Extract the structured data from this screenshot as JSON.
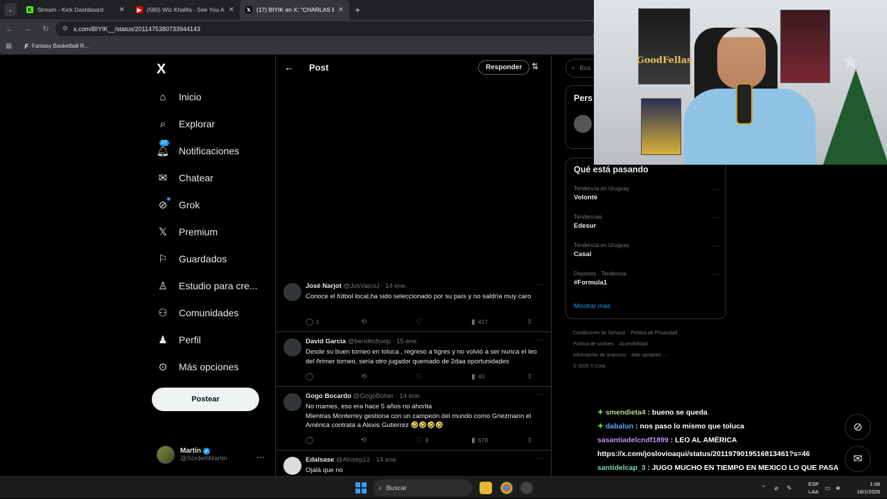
{
  "browser": {
    "tabs": [
      {
        "title": "Stream - Kick Dashboard",
        "favicon": "kick-icon",
        "active": false
      },
      {
        "title": "(580) Wiz Khalifa - See You Again",
        "favicon": "youtube-icon",
        "active": false
      },
      {
        "title": "(17) BIYIK en X: \"CHARLAS EN TO",
        "favicon": "x-icon",
        "active": true
      }
    ],
    "new_tab": "+",
    "url": "x.com/BIYIK__/status/2011475380733944143",
    "bookmarks": [
      {
        "label": "Fantasy Basketball R..."
      }
    ]
  },
  "nav": {
    "logo": "X",
    "items": [
      {
        "label": "Inicio",
        "icon": "home-icon"
      },
      {
        "label": "Explorar",
        "icon": "search-icon"
      },
      {
        "label": "Notificaciones",
        "icon": "bell-icon",
        "badge": "17"
      },
      {
        "label": "Chatear",
        "icon": "mail-icon"
      },
      {
        "label": "Grok",
        "icon": "grok-icon"
      },
      {
        "label": "Premium",
        "icon": "x-icon"
      },
      {
        "label": "Guardados",
        "icon": "bookmark-icon"
      },
      {
        "label": "Estudio para cre...",
        "icon": "studio-icon"
      },
      {
        "label": "Comunidades",
        "icon": "communities-icon"
      },
      {
        "label": "Perfil",
        "icon": "profile-icon"
      },
      {
        "label": "Más opciones",
        "icon": "more-icon"
      }
    ],
    "post_button": "Postear",
    "profile": {
      "name": "Martín",
      "handle": "@SordelliMartin"
    }
  },
  "post": {
    "title": "Post",
    "reply_button": "Responder",
    "replies": [
      {
        "name": "José Narjot",
        "handle": "@JosVaicoJ",
        "date": "14 ene.",
        "text": "Conoce el fútbol local,ha sido seleccionado por su país y no saldría muy caro",
        "replies": "1",
        "reposts": "",
        "likes": "",
        "views": "417"
      },
      {
        "name": "David Garcia",
        "handle": "@benditoboop",
        "date": "15 ene.",
        "text": "Desde su buen torneo en toluca , regreso a tigres y no volvió a ser nunca el leo del ñrimer torneo,  sería otro jugador quemado de 2daa oportunidades",
        "replies": "",
        "reposts": "",
        "likes": "",
        "views": "40"
      },
      {
        "name": "Gogo Bocardo",
        "handle": "@GogoBoher",
        "date": "14 ene.",
        "text": "No mames, eso era hace 5 años no ahorita\nMientras Monterrey gestiona con un campeón del mundo como Griezmann el América contrata a Alexis Gutierrez 🤣🤣🤣🤣",
        "replies": "",
        "reposts": "",
        "likes": "9",
        "views": "678"
      },
      {
        "name": "Edalsase",
        "handle": "@Alnsep12",
        "date": "14 ene.",
        "text": "Ojalá que no",
        "replies": "",
        "reposts": "",
        "likes": "",
        "views": ""
      }
    ]
  },
  "sidebar": {
    "search_placeholder": "Bus",
    "card_title": "Pers",
    "trends_title": "Qué está pasando",
    "trends": [
      {
        "context": "Tendencia en Uruguay",
        "name": "Volonté"
      },
      {
        "context": "Tendencias",
        "name": "Edesur"
      },
      {
        "context": "Tendencia en Uruguay",
        "name": "Casal"
      },
      {
        "context": "Deportes · Tendencia",
        "name": "#Formula1"
      }
    ],
    "show_more": "Mostrar más",
    "footer": [
      "Condiciones de Servicio",
      "Política de Privacidad",
      "Política de cookies",
      "Accesibilidad",
      "Información de anuncios",
      "Más opciones ···",
      "© 2026 X Corp."
    ]
  },
  "webcam": {
    "poster_text": "GoodFellas"
  },
  "chat": [
    {
      "user": "smendieta4",
      "message": ": bueno se queda",
      "badge": true
    },
    {
      "user": "dabalun",
      "message": ": nos paso lo mismo que toluca",
      "badge": true
    },
    {
      "user": "sasantiadelcndf1899",
      "message": ": LEO AL AMÉRICA",
      "badge": false
    },
    {
      "user": "",
      "message": "https://x.com/joslovioaqui/status/2011979019516813461?s=46",
      "badge": false
    },
    {
      "user": "santidelcap_3",
      "message": ": JUGO MUCHO EN TIEMPO EN MEXICO LO QUE PASA",
      "badge": false
    }
  ],
  "taskbar": {
    "search": "Buscar",
    "lang_line1": "ESP",
    "lang_line2": "LAA",
    "time": "1:08",
    "date": "16/1/2026"
  }
}
